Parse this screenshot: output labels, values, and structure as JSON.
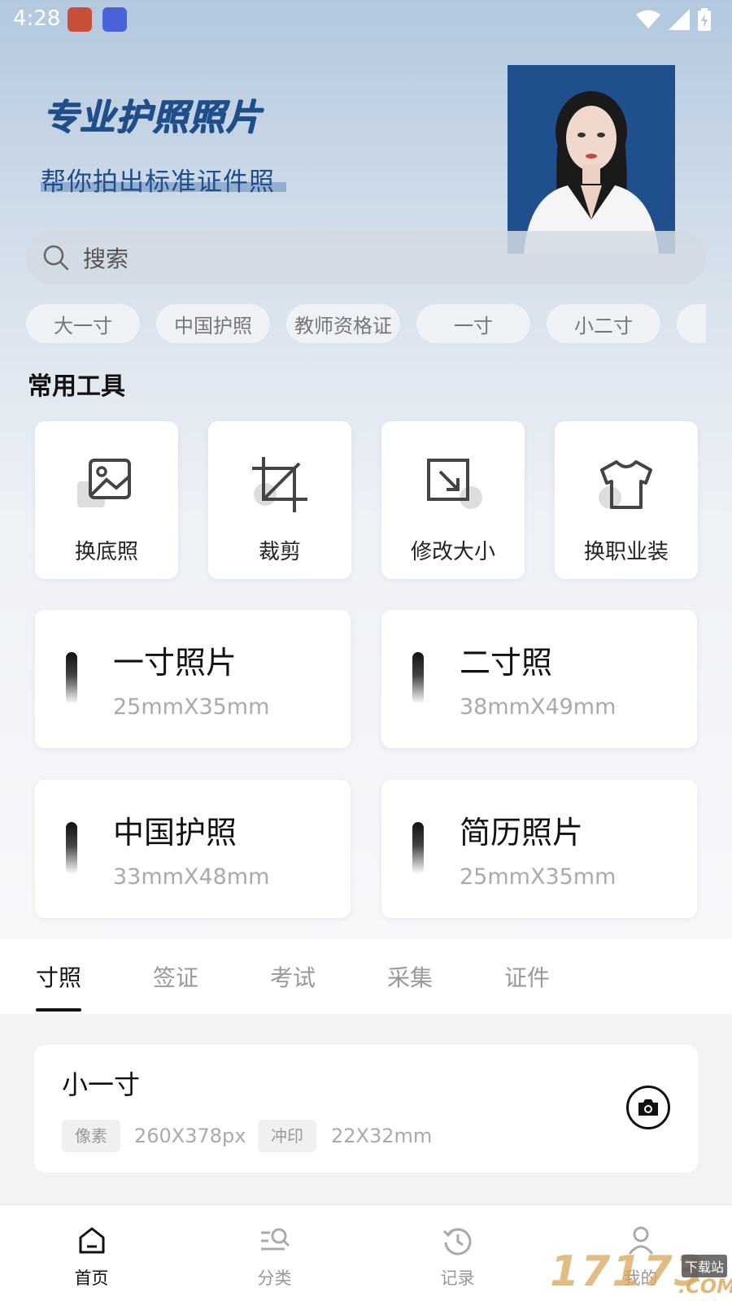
{
  "status_bar": {
    "time": "4:28"
  },
  "hero": {
    "title": "专业护照照片",
    "subtitle": "帮你拍出标准证件照"
  },
  "search": {
    "placeholder": "搜索"
  },
  "chips": [
    "大一寸",
    "中国护照",
    "教师资格证",
    "一寸",
    "小二寸"
  ],
  "tools_section": {
    "title": "常用工具"
  },
  "tools": [
    {
      "label": "换底照",
      "icon": "image-gallery-icon"
    },
    {
      "label": "裁剪",
      "icon": "crop-icon"
    },
    {
      "label": "修改大小",
      "icon": "resize-icon"
    },
    {
      "label": "换职业装",
      "icon": "shirt-icon"
    }
  ],
  "size_cards": [
    {
      "name": "一寸照片",
      "dims": "25mmX35mm"
    },
    {
      "name": "二寸照",
      "dims": "38mmX49mm"
    },
    {
      "name": "中国护照",
      "dims": "33mmX48mm"
    },
    {
      "name": "简历照片",
      "dims": "25mmX35mm"
    }
  ],
  "tabs": [
    "寸照",
    "签证",
    "考试",
    "采集",
    "证件"
  ],
  "photo_card": {
    "title": "小一寸",
    "pixel_tag": "像素",
    "pixel_value": "260X378px",
    "print_tag": "冲印",
    "print_value": "22X32mm"
  },
  "bottom_nav": [
    {
      "label": "首页",
      "icon": "home-icon",
      "active": true
    },
    {
      "label": "分类",
      "icon": "category-search-icon",
      "active": false
    },
    {
      "label": "记录",
      "icon": "history-icon",
      "active": false
    },
    {
      "label": "我的",
      "icon": "profile-icon",
      "active": false
    }
  ],
  "watermark": {
    "text": "17173",
    "badge": "下载站",
    "suffix": ".COM"
  },
  "colors": {
    "accent": "#1f4e8a",
    "photo_background": "#1f4f8c"
  }
}
